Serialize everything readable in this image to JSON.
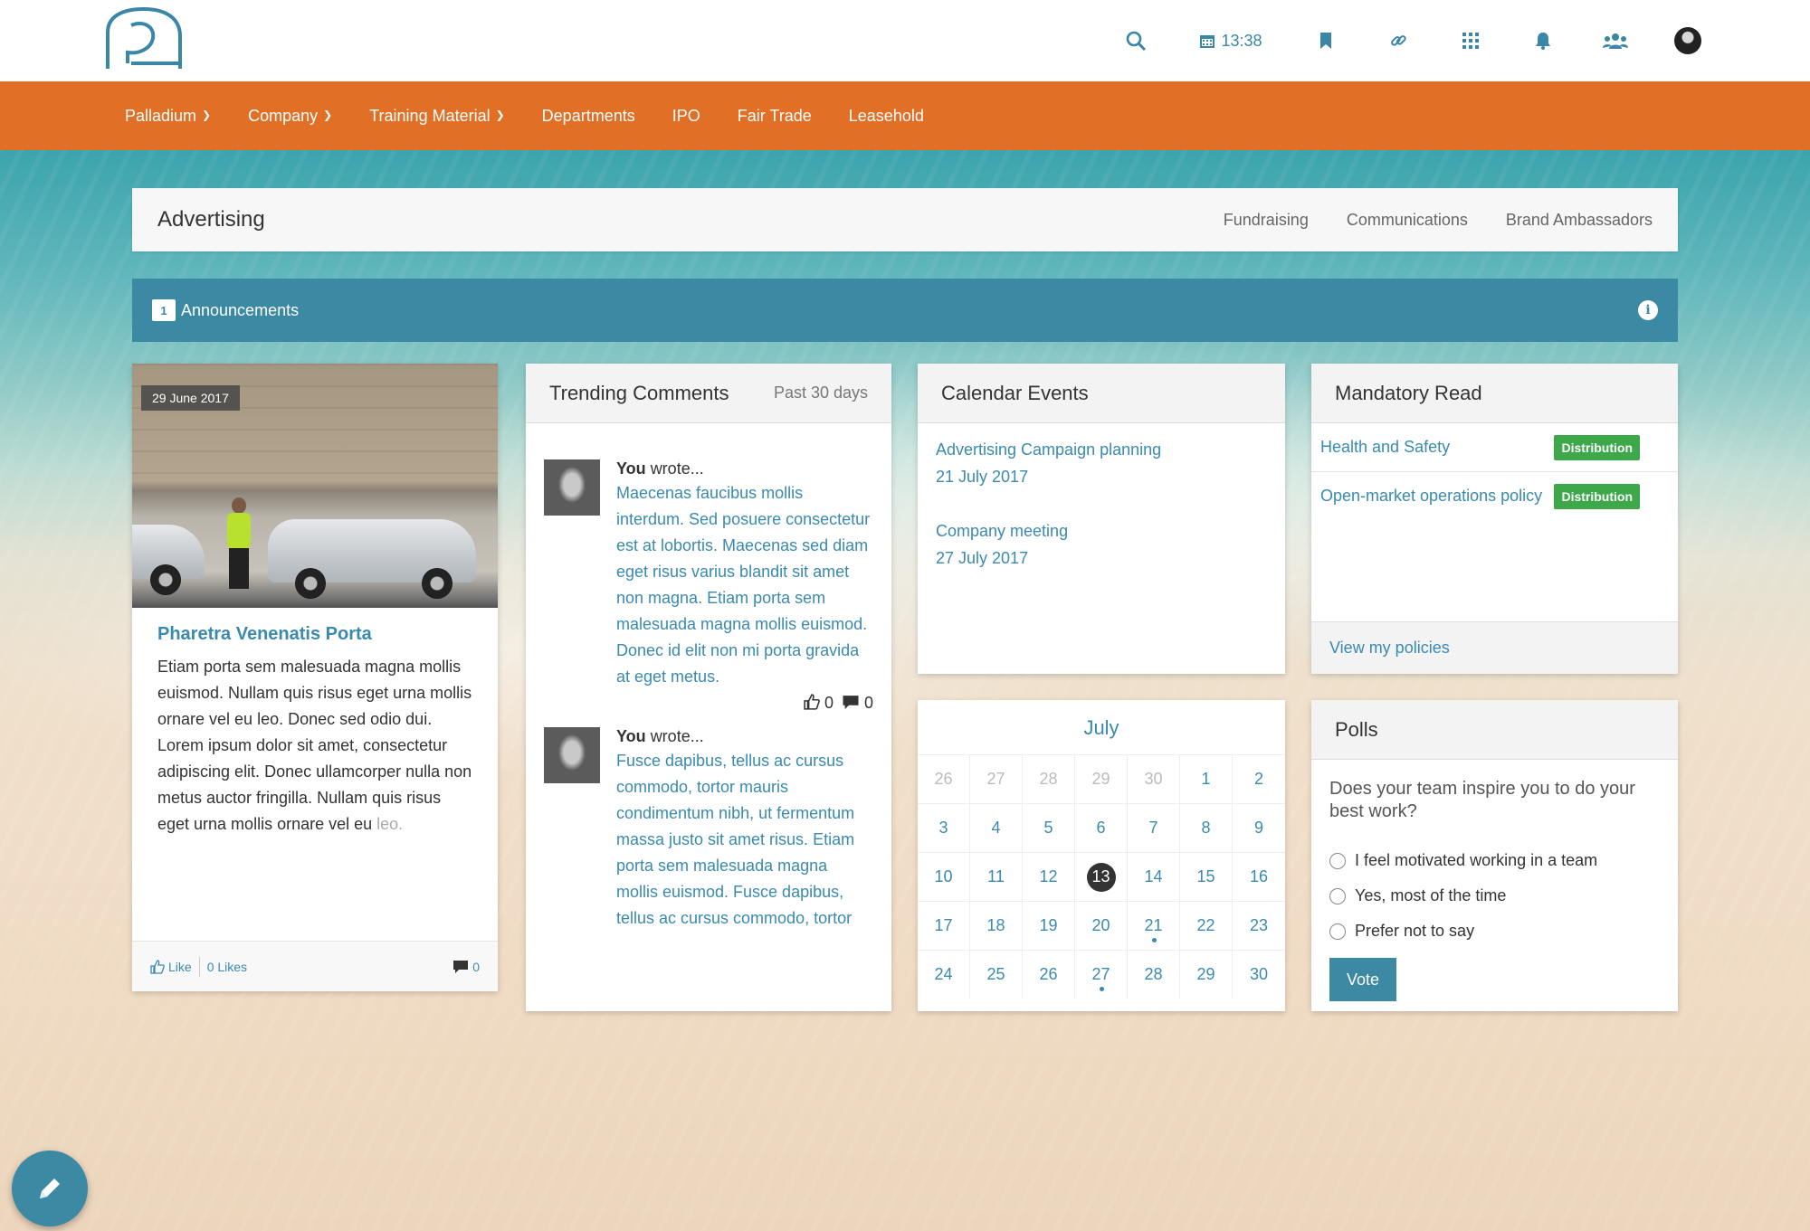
{
  "header": {
    "logo_name": "elephant-logo",
    "time": "13:38",
    "icons": [
      "search-icon",
      "calendar-icon",
      "bookmark-icon",
      "link-icon",
      "apps-grid-icon",
      "bell-icon",
      "people-icon",
      "user-avatar"
    ]
  },
  "nav": {
    "items": [
      {
        "label": "Palladium",
        "dropdown": true
      },
      {
        "label": "Company",
        "dropdown": true
      },
      {
        "label": "Training Material",
        "dropdown": true
      },
      {
        "label": "Departments",
        "dropdown": false
      },
      {
        "label": "IPO",
        "dropdown": false
      },
      {
        "label": "Fair Trade",
        "dropdown": false
      },
      {
        "label": "Leasehold",
        "dropdown": false
      }
    ],
    "color": "#e26f26"
  },
  "page": {
    "title": "Advertising",
    "subnav": [
      "Fundraising",
      "Communications",
      "Brand Ambassadors"
    ]
  },
  "announcements": {
    "count": "1",
    "label": "Announcements"
  },
  "news": {
    "date": "29 June 2017",
    "title": "Pharetra Venenatis Porta",
    "text": "Etiam porta sem malesuada magna mollis euismod. Nullam quis risus eget urna mollis ornare vel eu leo. Donec sed odio dui. Lorem ipsum dolor sit amet, consectetur adipiscing elit. Donec ullamcorper nulla non metus auctor fringilla. Nullam quis risus eget urna mollis ornare vel eu",
    "text_fade": "leo.",
    "like_label": "Like",
    "likes_label": "0 Likes",
    "comments": "0"
  },
  "trending": {
    "title": "Trending Comments",
    "period": "Past 30 days",
    "comments": [
      {
        "author": "You",
        "verb": "wrote...",
        "text": "Maecenas faucibus mollis interdum. Sed posuere consectetur est at lobortis. Maecenas sed diam eget risus varius blandit sit amet non magna. Etiam porta sem malesuada magna mollis euismod. Donec id elit non mi porta gravida at eget metus.",
        "likes": "0",
        "replies": "0"
      },
      {
        "author": "You",
        "verb": "wrote...",
        "text": "Fusce dapibus, tellus ac cursus commodo, tortor mauris condimentum nibh, ut fermentum massa justo sit amet risus. Etiam porta sem malesuada magna mollis euismod. Fusce dapibus, tellus ac cursus commodo, tortor"
      }
    ]
  },
  "calendar_events": {
    "title": "Calendar Events",
    "events": [
      {
        "name": "Advertising Campaign planning",
        "date": "21 July 2017"
      },
      {
        "name": "Company meeting",
        "date": "27 July 2017"
      }
    ]
  },
  "mandatory": {
    "title": "Mandatory Read",
    "items": [
      {
        "title": "Health and Safety",
        "badge": "Distribution"
      },
      {
        "title": "Open-market operations policy",
        "badge": "Distribution"
      }
    ],
    "footer_link": "View my policies",
    "badge_color": "#3ca84a"
  },
  "calendar": {
    "month": "July",
    "weeks": [
      [
        "26",
        "27",
        "28",
        "29",
        "30",
        "1",
        "2"
      ],
      [
        "3",
        "4",
        "5",
        "6",
        "7",
        "8",
        "9"
      ],
      [
        "10",
        "11",
        "12",
        "13",
        "14",
        "15",
        "16"
      ],
      [
        "17",
        "18",
        "19",
        "20",
        "21",
        "22",
        "23"
      ],
      [
        "24",
        "25",
        "26",
        "27",
        "28",
        "29",
        "30"
      ]
    ],
    "today": "13",
    "event_days": [
      "21",
      "27"
    ]
  },
  "polls": {
    "title": "Polls",
    "question": "Does your team inspire you to do your best work?",
    "options": [
      "I feel motivated working in a team",
      "Yes, most of the time",
      "Prefer not to say"
    ],
    "vote_label": "Vote"
  },
  "fab": {
    "icon": "pencil-icon"
  },
  "colors": {
    "accent": "#3b89a3",
    "link": "#3a8ab0"
  }
}
